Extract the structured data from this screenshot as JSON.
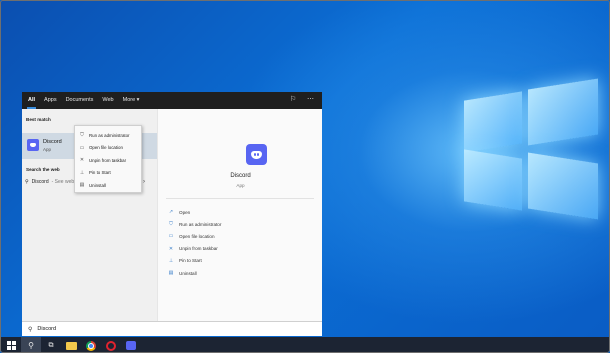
{
  "search_panel": {
    "tabs": [
      {
        "label": "All",
        "active": true
      },
      {
        "label": "Apps"
      },
      {
        "label": "Documents"
      },
      {
        "label": "Web"
      },
      {
        "label": "More ▾"
      }
    ],
    "top_icons": [
      "feedback-icon",
      "more-options-icon"
    ],
    "best_match_label": "Best match",
    "best_match": {
      "name": "Discord",
      "type": "App"
    },
    "search_web_label": "Search the web",
    "web_result": {
      "name": "Discord",
      "sub": "- See web results"
    },
    "context_menu": [
      {
        "label": "Run as administrator",
        "icon": "shield-icon"
      },
      {
        "label": "Open file location",
        "icon": "folder-icon"
      },
      {
        "label": "Unpin from taskbar",
        "icon": "unpin-icon"
      },
      {
        "label": "Pin to Start",
        "icon": "pin-icon"
      },
      {
        "label": "Uninstall",
        "icon": "trash-icon"
      }
    ],
    "right_pane": {
      "title": "Discord",
      "subtitle": "App",
      "actions": [
        {
          "label": "Open",
          "icon": "open-icon"
        },
        {
          "label": "Run as administrator",
          "icon": "shield-icon"
        },
        {
          "label": "Open file location",
          "icon": "folder-icon"
        },
        {
          "label": "Unpin from taskbar",
          "icon": "unpin-icon"
        },
        {
          "label": "Pin to Start",
          "icon": "pin-icon"
        },
        {
          "label": "Uninstall",
          "icon": "trash-icon"
        }
      ]
    }
  },
  "searchbox": {
    "value": "Discord"
  },
  "taskbar": {
    "items": [
      "start-button",
      "search-button",
      "task-view-button",
      "file-explorer",
      "chrome",
      "opera",
      "discord"
    ]
  },
  "colors": {
    "accent": "#3b8fde",
    "discord": "#5865f2",
    "taskbar": "#1c2433"
  }
}
